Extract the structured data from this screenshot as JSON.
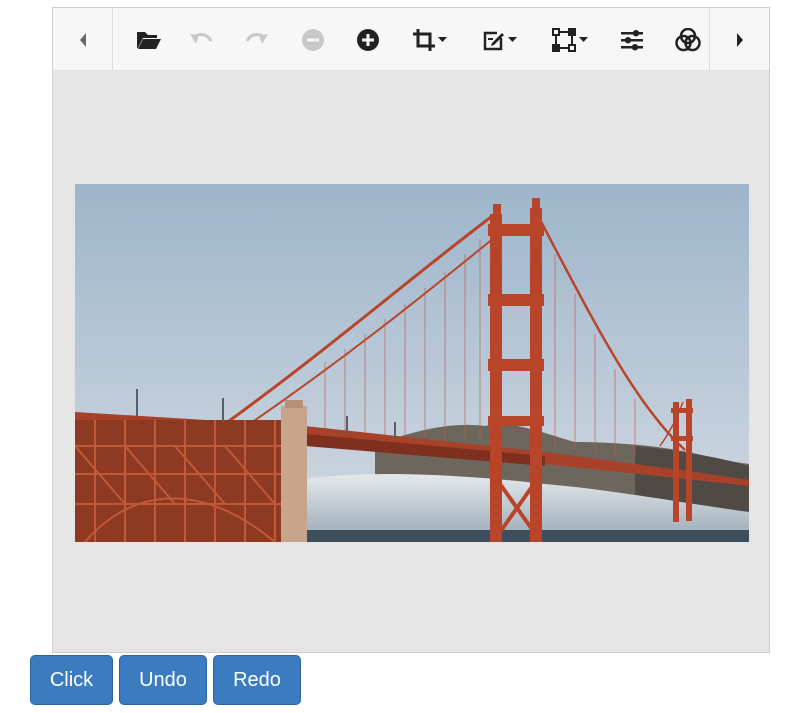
{
  "toolbar": {
    "items": [
      {
        "id": "prev",
        "icon": "caret-left-icon"
      },
      {
        "id": "open",
        "icon": "folder-open-icon"
      },
      {
        "id": "undo",
        "icon": "undo-icon",
        "disabled": true
      },
      {
        "id": "redo",
        "icon": "redo-icon",
        "disabled": true
      },
      {
        "id": "zoom-out",
        "icon": "zoom-out-icon",
        "disabled": true
      },
      {
        "id": "zoom-in",
        "icon": "zoom-in-icon"
      },
      {
        "id": "crop",
        "icon": "crop-icon",
        "dropdown": true
      },
      {
        "id": "annotate",
        "icon": "edit-icon",
        "dropdown": true
      },
      {
        "id": "transform",
        "icon": "transform-icon",
        "dropdown": true
      },
      {
        "id": "adjust",
        "icon": "sliders-icon"
      },
      {
        "id": "filter",
        "icon": "filter-icon"
      },
      {
        "id": "next",
        "icon": "caret-right-icon"
      }
    ]
  },
  "canvas": {
    "image": "golden-gate-bridge-photo",
    "background": "#e5e5e5"
  },
  "buttons": {
    "click_label": "Click",
    "undo_label": "Undo",
    "redo_label": "Redo"
  },
  "colors": {
    "button_blue": "#3b7cc0",
    "bridge_red": "#b8452a",
    "sky": "#a9bccd"
  }
}
